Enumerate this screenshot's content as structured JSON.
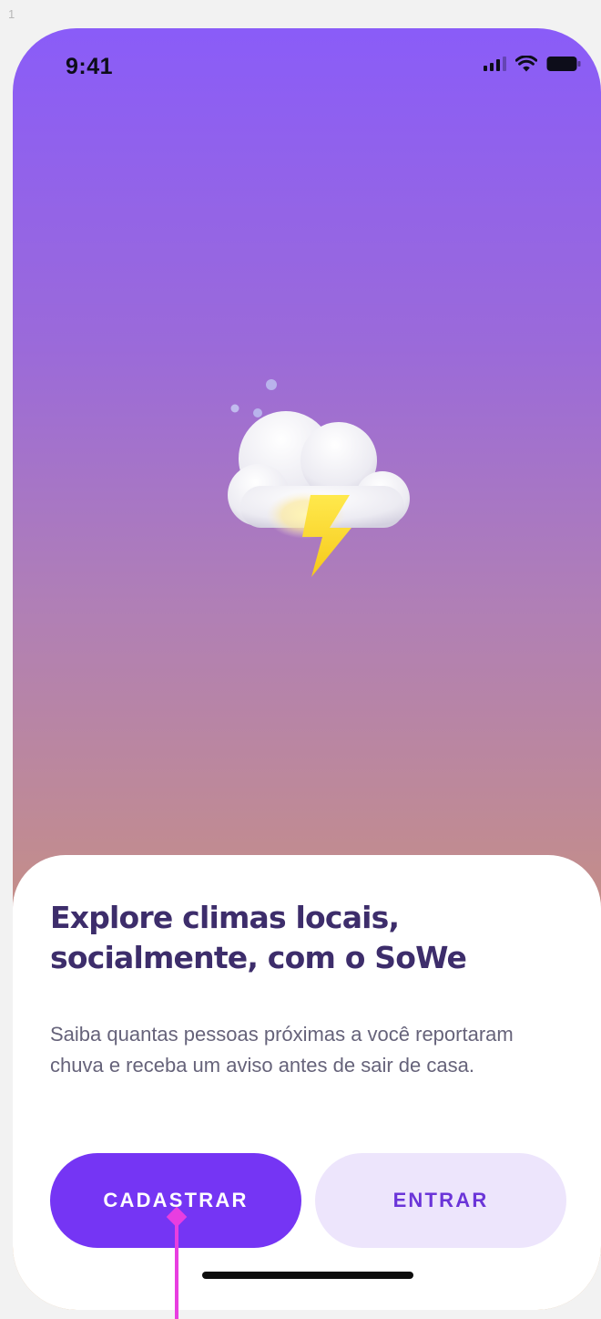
{
  "canvas": {
    "frame_label": "1"
  },
  "status_bar": {
    "time": "9:41"
  },
  "sheet": {
    "headline_line1": "Explore climas locais,",
    "headline_line2": "socialmente, com o SoWe",
    "description": "Saiba quantas pessoas próximas a você reportaram chuva e receba um aviso antes de sair de casa.",
    "primary_button": "CADASTRAR",
    "secondary_button": "ENTRAR"
  },
  "colors": {
    "gradient_top": "#8a5cf8",
    "gradient_bottom": "#d19a5f",
    "headline": "#3d2d6b",
    "primary": "#7535f4",
    "secondary_bg": "#ede5fc",
    "annotation": "#e83ee0"
  },
  "icons": [
    "signal-icon",
    "wifi-icon",
    "battery-icon",
    "storm-cloud-moon-icon"
  ]
}
